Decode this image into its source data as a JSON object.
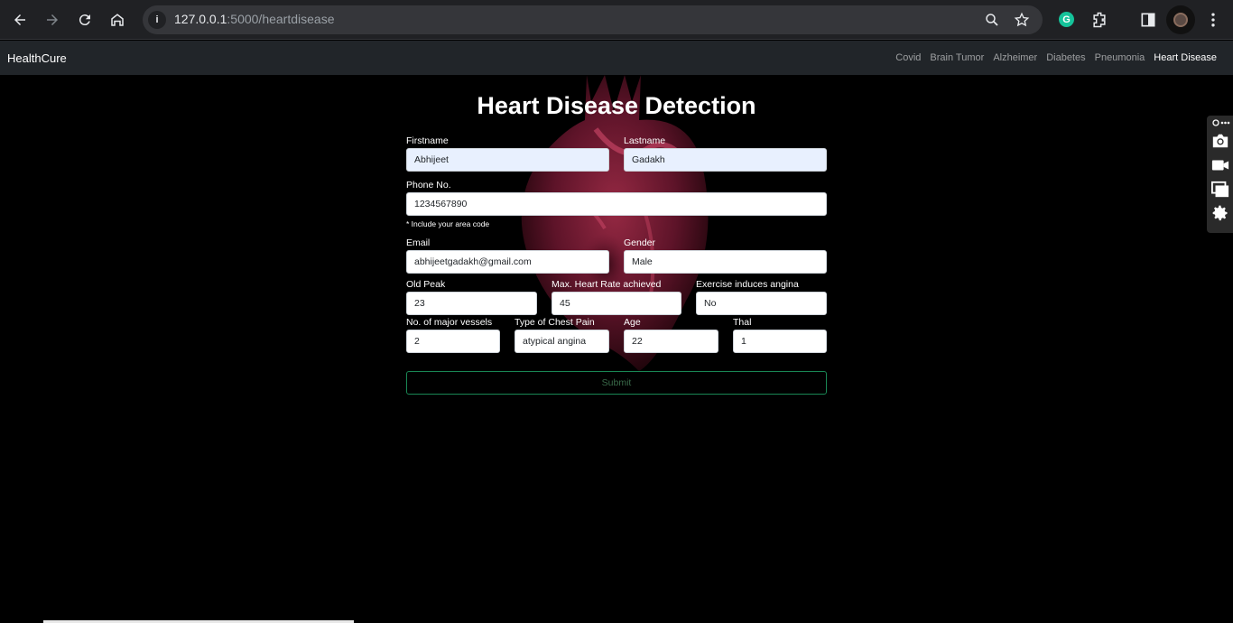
{
  "browser": {
    "url_host": "127.0.0.1",
    "url_rest": ":5000/heartdisease"
  },
  "navbar": {
    "brand": "HealthCure",
    "links": [
      "Covid",
      "Brain Tumor",
      "Alzheimer",
      "Diabetes",
      "Pneumonia",
      "Heart Disease"
    ],
    "active": "Heart Disease"
  },
  "form": {
    "title": "Heart Disease Detection",
    "firstname": {
      "label": "Firstname",
      "value": "Abhijeet"
    },
    "lastname": {
      "label": "Lastname",
      "value": "Gadakh"
    },
    "phone": {
      "label": "Phone No.",
      "value": "1234567890",
      "help": "* Include your area code"
    },
    "email": {
      "label": "Email",
      "value": "abhijeetgadakh@gmail.com"
    },
    "gender": {
      "label": "Gender",
      "value": "Male"
    },
    "old_peak": {
      "label": "Old Peak",
      "value": "23"
    },
    "max_heart_rate": {
      "label": "Max. Heart Rate achieved",
      "value": "45"
    },
    "exercise_angina": {
      "label": "Exercise induces angina",
      "value": "No"
    },
    "major_vessels": {
      "label": "No. of major vessels",
      "value": "2"
    },
    "chest_pain": {
      "label": "Type of Chest Pain",
      "value": "atypical angina"
    },
    "age": {
      "label": "Age",
      "value": "22"
    },
    "thal": {
      "label": "Thal",
      "value": "1"
    },
    "submit_label": "Submit"
  },
  "colors": {
    "navbar_bg": "#212529",
    "submit_border": "#198754",
    "autofill_bg": "#e8f0fe"
  }
}
